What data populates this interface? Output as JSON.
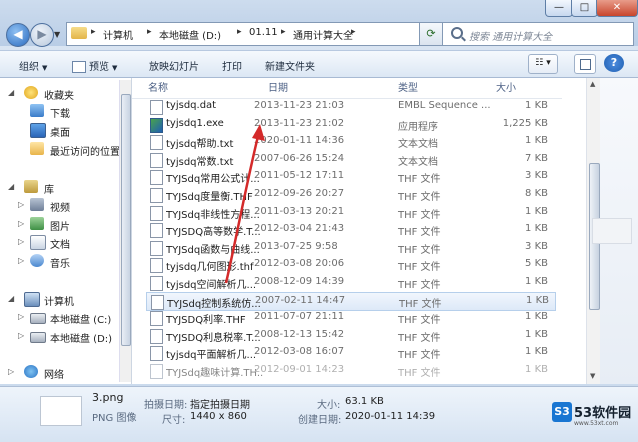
{
  "address": {
    "crumbs": [
      "计算机",
      "本地磁盘 (D:)",
      "01.11",
      "通用计算大全"
    ],
    "search_placeholder": "搜索 通用计算大全"
  },
  "window": {
    "minimize": "—",
    "maximize": "□",
    "close": "✕"
  },
  "toolbar": {
    "organize": "组织",
    "preview": "预览",
    "slideshow": "放映幻灯片",
    "print": "打印",
    "new_folder": "新建文件夹"
  },
  "nav": {
    "favorites": "收藏夹",
    "downloads": "下载",
    "desktop": "桌面",
    "recent": "最近访问的位置",
    "libraries": "库",
    "videos": "视频",
    "pictures": "图片",
    "documents": "文档",
    "music": "音乐",
    "computer": "计算机",
    "drive_c": "本地磁盘 (C:)",
    "drive_d": "本地磁盘 (D:)",
    "network": "网络"
  },
  "columns": {
    "name": "名称",
    "date": "日期",
    "type": "类型",
    "size": "大小"
  },
  "files": [
    {
      "name": "tyjsdq.dat",
      "date": "2013-11-23 21:03",
      "type": "EMBL Sequence ...",
      "size": "1 KB"
    },
    {
      "name": "tyjsdq1.exe",
      "date": "2013-11-23 21:02",
      "type": "应用程序",
      "size": "1,225 KB"
    },
    {
      "name": "tyjsdq帮助.txt",
      "date": "2020-01-11 14:36",
      "type": "文本文档",
      "size": "1 KB"
    },
    {
      "name": "tyjsdq常数.txt",
      "date": "2007-06-26 15:24",
      "type": "文本文档",
      "size": "7 KB"
    },
    {
      "name": "TYJSdq常用公式计...",
      "date": "2011-05-12 17:11",
      "type": "THF 文件",
      "size": "3 KB"
    },
    {
      "name": "TYJSdq度量衡.THF",
      "date": "2012-09-26 20:27",
      "type": "THF 文件",
      "size": "8 KB"
    },
    {
      "name": "TYJSdq非线性方程...",
      "date": "2011-03-13 20:21",
      "type": "THF 文件",
      "size": "1 KB"
    },
    {
      "name": "TYJSDQ高等数学.T...",
      "date": "2012-03-04 21:43",
      "type": "THF 文件",
      "size": "1 KB"
    },
    {
      "name": "TYJSdq函数与曲线...",
      "date": "2013-07-25 9:58",
      "type": "THF 文件",
      "size": "3 KB"
    },
    {
      "name": "tyjsdq几何图形.thf",
      "date": "2012-03-08 20:06",
      "type": "THF 文件",
      "size": "5 KB"
    },
    {
      "name": "tyjsdq空间解析几...",
      "date": "2008-12-09 14:39",
      "type": "THF 文件",
      "size": "1 KB"
    },
    {
      "name": "TYJSdq控制系统仿...",
      "date": "2007-02-11 14:47",
      "type": "THF 文件",
      "size": "1 KB"
    },
    {
      "name": "TYJSDQ利率.THF",
      "date": "2011-07-07 21:11",
      "type": "THF 文件",
      "size": "1 KB"
    },
    {
      "name": "TYJSDQ利息税率.T...",
      "date": "2008-12-13 15:42",
      "type": "THF 文件",
      "size": "1 KB"
    },
    {
      "name": "tyjsdq平面解析几...",
      "date": "2012-03-08 16:07",
      "type": "THF 文件",
      "size": "1 KB"
    },
    {
      "name": "TYJSdq趣味计算.TH...",
      "date": "2012-09-01 14:23",
      "type": "THF 文件",
      "size": "1 KB"
    }
  ],
  "details": {
    "filename": "3.png",
    "filetype": "PNG 图像",
    "date_taken_label": "拍摄日期:",
    "date_taken_value": "指定拍摄日期",
    "dimensions_label": "尺寸:",
    "dimensions_value": "1440 x 860",
    "size_label": "大小:",
    "size_value": "63.1 KB",
    "created_label": "创建日期:",
    "created_value": "2020-01-11 14:39"
  },
  "watermark": {
    "mark": "S3",
    "brand": "53软件园",
    "url": "www.53xt.com"
  },
  "colors": {
    "annotation_arrow": "#d42a2a",
    "selection": "#dde9f8"
  }
}
